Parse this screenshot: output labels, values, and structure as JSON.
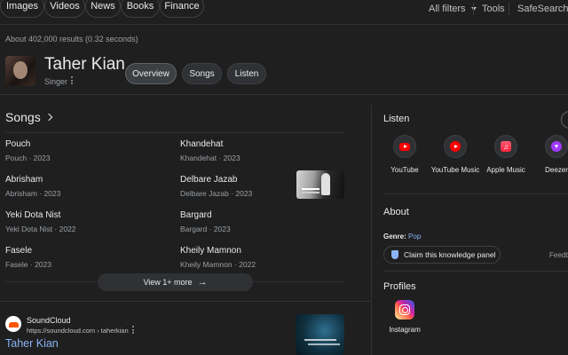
{
  "nav": {
    "tabs": [
      "Images",
      "Videos",
      "News",
      "Books",
      "Finance"
    ],
    "all_filters": "All filters",
    "tools": "Tools",
    "safesearch": "SafeSearch"
  },
  "results_stats": "About 402,000 results (0.32 seconds)",
  "entity": {
    "name": "Taher Kian",
    "type": "Singer",
    "tabs": [
      "Overview",
      "Songs",
      "Listen"
    ],
    "active_tab": "Overview"
  },
  "songs": {
    "title": "Songs",
    "items": [
      {
        "title": "Pouch",
        "sub": "Pouch · 2023"
      },
      {
        "title": "Khandehat",
        "sub": "Khandehat · 2023"
      },
      {
        "title": "Abrisham",
        "sub": "Abrisham · 2023"
      },
      {
        "title": "Delbare Jazab",
        "sub": "Delbare Jazab · 2023"
      },
      {
        "title": "Yeki Dota Nist",
        "sub": "Yeki Dota Nist · 2022"
      },
      {
        "title": "Bargard",
        "sub": "Bargard · 2023"
      },
      {
        "title": "Fasele",
        "sub": "Fasele · 2023"
      },
      {
        "title": "Kheily Mamnon",
        "sub": "Kheily Mamnon · 2022"
      }
    ],
    "view_more": "View 1+ more"
  },
  "result": {
    "source": "SoundCloud",
    "url": "https://soundcloud.com › taherkian",
    "title": "Taher Kian"
  },
  "sidebar": {
    "listen_title": "Listen",
    "listen_items": [
      {
        "label": "YouTube",
        "icon": "youtube-icon"
      },
      {
        "label": "YouTube Music",
        "icon": "youtube-music-icon"
      },
      {
        "label": "Apple Music",
        "icon": "apple-music-icon"
      },
      {
        "label": "Deezer",
        "icon": "deezer-icon"
      }
    ],
    "about_title": "About",
    "genre_label": "Genre:",
    "genre_value": "Pop",
    "claim": "Claim this knowledge panel",
    "feedback": "Feedback",
    "profiles_title": "Profiles",
    "profiles": [
      {
        "label": "Instagram",
        "icon": "instagram-icon"
      }
    ]
  },
  "colors": {
    "background": "#1f1f1f",
    "link": "#8ab4f8",
    "text": "#e8eaed",
    "muted": "#9aa0a6"
  }
}
